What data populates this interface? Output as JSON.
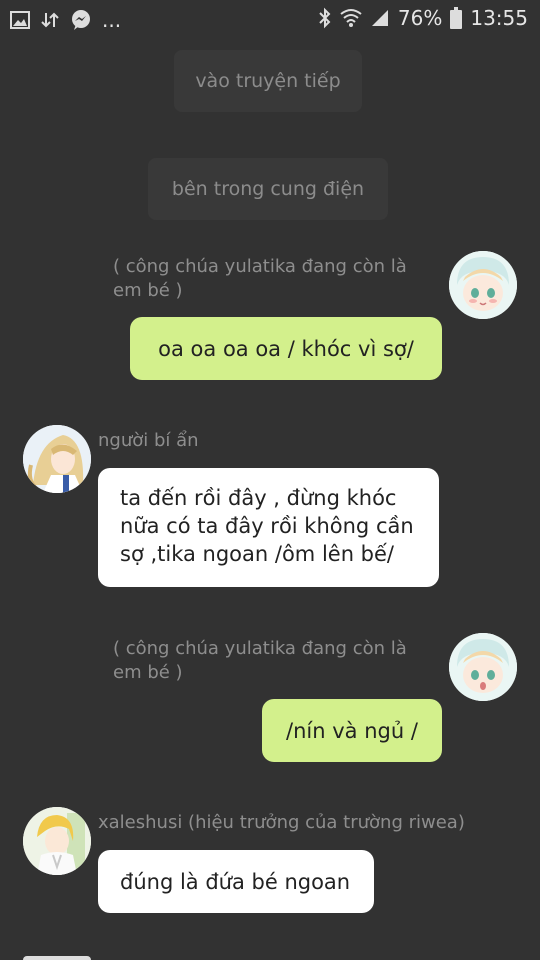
{
  "status_bar": {
    "battery": "76%",
    "time": "13:55",
    "more": "..."
  },
  "notices": [
    "vào truyện tiếp",
    "bên trong cung điện"
  ],
  "messages": [
    {
      "sender": "( công chúa yulatika đang còn là em bé )",
      "text": "oa oa oa oa / khóc vì sợ/"
    },
    {
      "sender": "người bí ẩn",
      "text": "ta đến rồi đây , đừng khóc nữa có ta đây rồi không cần sợ ,tika ngoan /ôm lên bế/"
    },
    {
      "sender": "( công chúa yulatika đang còn là em bé )",
      "text": "/nín và ngủ /"
    },
    {
      "sender": "xaleshusi (hiệu trưởng của trường riwea)",
      "text": "đúng là đứa bé ngoan"
    }
  ],
  "icons": [
    "image-icon",
    "transfer-icon",
    "messenger-icon",
    "bluetooth-icon",
    "wifi-icon",
    "signal-icon",
    "battery-icon"
  ],
  "colors": {
    "background": "#323232",
    "green_bubble": "#d3f08c",
    "white_bubble": "#ffffff",
    "notice": "#393939"
  }
}
